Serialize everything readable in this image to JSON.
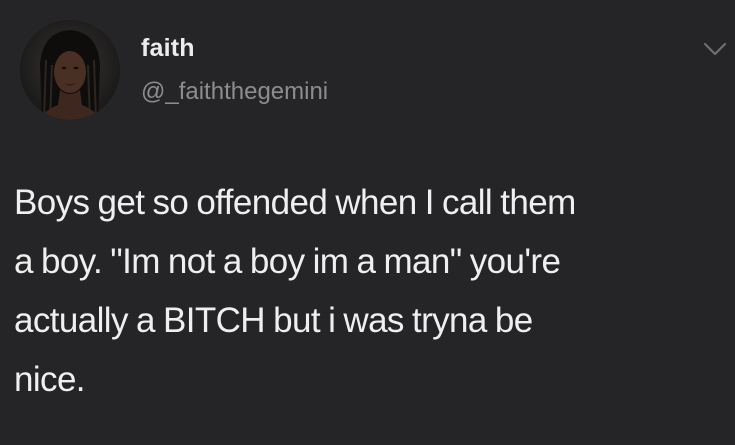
{
  "author": {
    "display_name": "faith",
    "handle": "@_faiththegemini",
    "avatar_icon": "profile-photo"
  },
  "menu": {
    "icon": "chevron-down-icon"
  },
  "tweet": {
    "lines": [
      "Boys get so offended when I call them",
      "a boy. \"Im not a boy im a man\" you're",
      "actually a BITCH but i was tryna be",
      "nice."
    ]
  },
  "colors": {
    "background": "#252527",
    "text": "#efefef",
    "secondary_text": "#8d8d90"
  }
}
